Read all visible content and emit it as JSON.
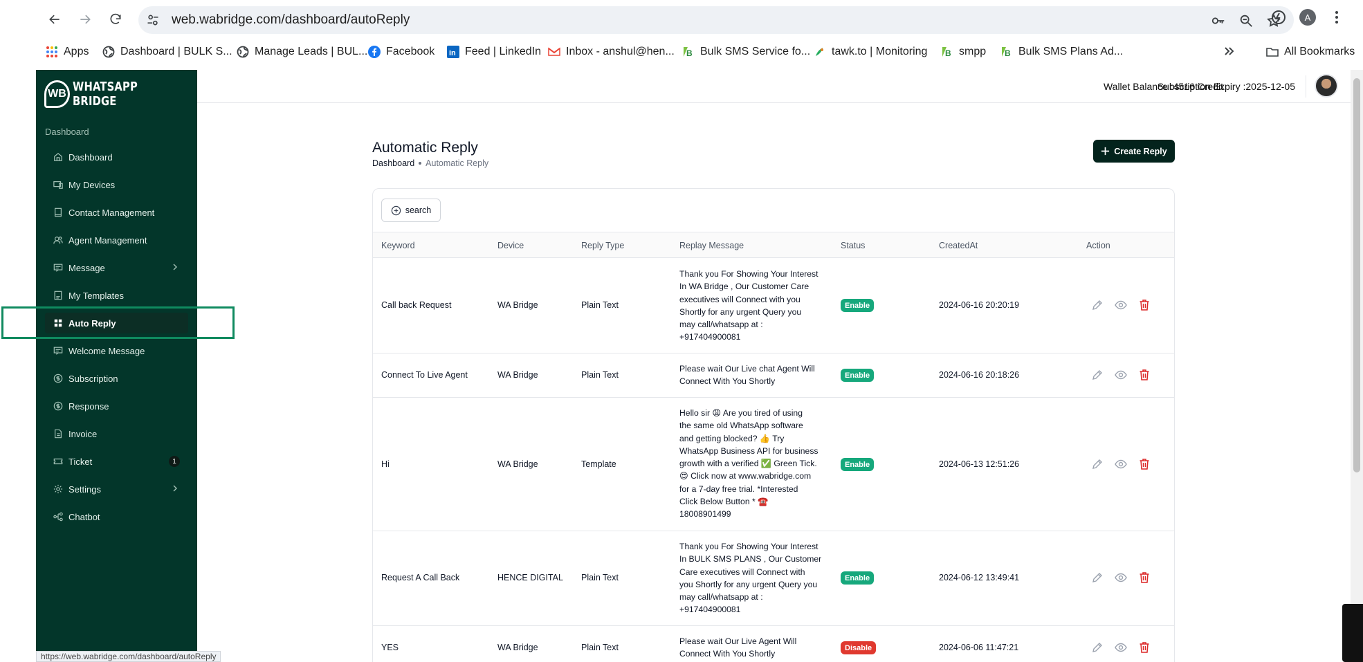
{
  "browser": {
    "url": "web.wabridge.com/dashboard/autoReply",
    "profile_initial": "A",
    "bookmarks": [
      {
        "label": "Apps",
        "icon": "apps-grid-icon"
      },
      {
        "label": "Dashboard | BULK S...",
        "icon": "globe-icon"
      },
      {
        "label": "Manage Leads | BUL...",
        "icon": "globe-icon"
      },
      {
        "label": "Facebook",
        "icon": "facebook-icon"
      },
      {
        "label": "Feed | LinkedIn",
        "icon": "linkedin-icon"
      },
      {
        "label": "Inbox - anshul@hen...",
        "icon": "gmail-icon"
      },
      {
        "label": "Bulk SMS Service fo...",
        "icon": "bulksms-icon"
      },
      {
        "label": "tawk.to | Monitoring",
        "icon": "tawk-icon"
      },
      {
        "label": "smpp",
        "icon": "bulksms-icon"
      },
      {
        "label": "Bulk SMS Plans Ad...",
        "icon": "bulksms-icon"
      }
    ],
    "all_bookmarks": "All Bookmarks",
    "status_url": "https://web.wabridge.com/dashboard/autoReply"
  },
  "sidebar": {
    "logo_mark": "WB",
    "logo_text": "WHATSAPP BRIDGE",
    "section": "Dashboard",
    "items": [
      {
        "label": "Dashboard",
        "icon": "home-icon"
      },
      {
        "label": "My Devices",
        "icon": "devices-icon"
      },
      {
        "label": "Contact Management",
        "icon": "contact-book-icon"
      },
      {
        "label": "Agent Management",
        "icon": "users-icon"
      },
      {
        "label": "Message",
        "icon": "message-icon"
      },
      {
        "label": "My Templates",
        "icon": "template-icon"
      },
      {
        "label": "Auto Reply",
        "icon": "grid-icon"
      },
      {
        "label": "Welcome Message",
        "icon": "message-icon"
      },
      {
        "label": "Subscription",
        "icon": "coin-icon"
      },
      {
        "label": "Response",
        "icon": "coin-icon"
      },
      {
        "label": "Invoice",
        "icon": "invoice-icon"
      },
      {
        "label": "Ticket",
        "icon": "ticket-icon",
        "badge": "1"
      },
      {
        "label": "Settings",
        "icon": "gear-icon"
      },
      {
        "label": "Chatbot",
        "icon": "flow-icon"
      }
    ]
  },
  "topbar": {
    "wallet": "Wallet Balance :4516 Credit",
    "expiry": "Subscription Expiry :2025-12-05"
  },
  "page": {
    "title": "Automatic Reply",
    "crumb_root": "Dashboard",
    "crumb_current": "Automatic Reply",
    "create_label": "Create Reply",
    "search_label": "search"
  },
  "table": {
    "headers": [
      "Keyword",
      "Device",
      "Reply Type",
      "Replay Message",
      "Status",
      "CreatedAt",
      "Action"
    ],
    "rows": [
      {
        "keyword": "Call back Request",
        "device": "WA Bridge",
        "type": "Plain Text",
        "message": [
          "Thank you For Showing Your Interest",
          "In WA Bridge , Our Customer Care",
          "executives will Connect with you",
          "Shortly for any urgent Query you",
          "may call/whatsapp at :",
          "+917404900081"
        ],
        "status": "Enable",
        "created": "2024-06-16 20:20:19"
      },
      {
        "keyword": "Connect To Live Agent",
        "device": "WA Bridge",
        "type": "Plain Text",
        "message": [
          "Please wait Our Live chat Agent Will",
          "Connect With You Shortly"
        ],
        "status": "Enable",
        "created": "2024-06-16 20:18:26"
      },
      {
        "keyword": "Hi",
        "device": "WA Bridge",
        "type": "Template",
        "message": [
          "Hello sir 😩 Are you tired of using",
          "the same old WhatsApp software",
          "and getting blocked? 👍 Try",
          "WhatsApp Business API for business",
          "growth with a verified ✅ Green Tick.",
          "😍 Click now at www.wabridge.com",
          "for a 7-day free trial. *Interested",
          "Click Below Button * ☎️",
          "18008901499"
        ],
        "status": "Enable",
        "created": "2024-06-13 12:51:26"
      },
      {
        "keyword": "Request A Call Back",
        "device": "HENCE DIGITAL",
        "type": "Plain Text",
        "message": [
          "Thank you For Showing Your Interest",
          "In BULK SMS PLANS , Our Customer",
          "Care executives will Connect with",
          "you Shortly for any urgent Query you",
          "may call/whatsapp at :",
          "+917404900081"
        ],
        "status": "Enable",
        "created": "2024-06-12 13:49:41"
      },
      {
        "keyword": "YES",
        "device": "WA Bridge",
        "type": "Plain Text",
        "message": [
          "Please wait Our Live Agent Will",
          "Connect With You Shortly"
        ],
        "status": "Disable",
        "created": "2024-06-06 11:47:21"
      }
    ]
  },
  "colors": {
    "sidebar_bg": "#03362a",
    "enable": "#16a87c",
    "disable": "#e0392f",
    "primary_btn": "#03231c"
  }
}
